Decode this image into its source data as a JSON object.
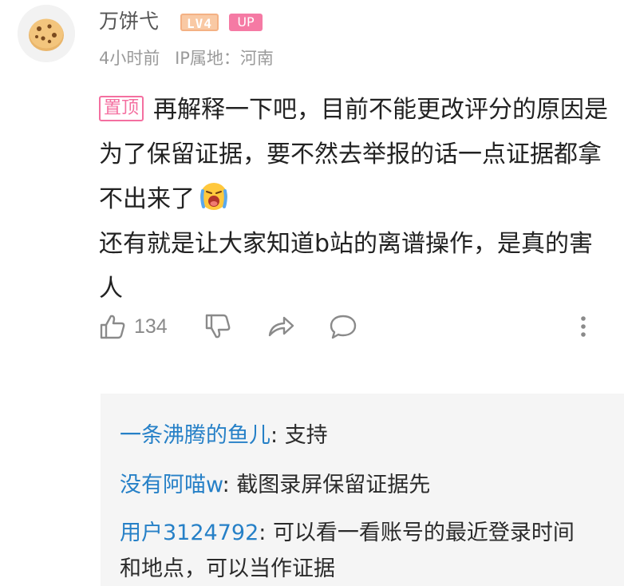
{
  "comment": {
    "username": "万饼弋",
    "level_badge": "LV4",
    "up_badge": "UP",
    "time": "4小时前",
    "ip_location": "IP属地：河南",
    "pinned_tag": "置顶",
    "text_line1": "再解释一下吧，目前不能更改评分的原因是为了保留证据，要不然去举报的话一点证据都拿不出来了",
    "text_line2": "还有就是让大家知道b站的离谱操作，是真的害人",
    "like_count": "134"
  },
  "replies": [
    {
      "user": "一条沸腾的鱼儿",
      "sep": ": ",
      "text": "支持"
    },
    {
      "user": "没有阿喵w",
      "sep": ": ",
      "text": "截图录屏保留证据先"
    },
    {
      "user": "用户3124792",
      "sep": ": ",
      "text": "可以看一看账号的最近登录时间和地点，可以当作证据"
    }
  ],
  "icons": {
    "avatar": "cookie-avatar",
    "emoji": "crying-emoji",
    "like": "thumbs-up-icon",
    "dislike": "thumbs-down-icon",
    "share": "share-icon",
    "reply": "comment-icon",
    "more": "more-vertical-icon"
  },
  "colors": {
    "pinned": "#f46fa0",
    "up_badge": "#f57aa4",
    "level_badge": "#f9c9a4",
    "reply_user": "#2680c7",
    "reply_bg": "#f5f5f5"
  }
}
